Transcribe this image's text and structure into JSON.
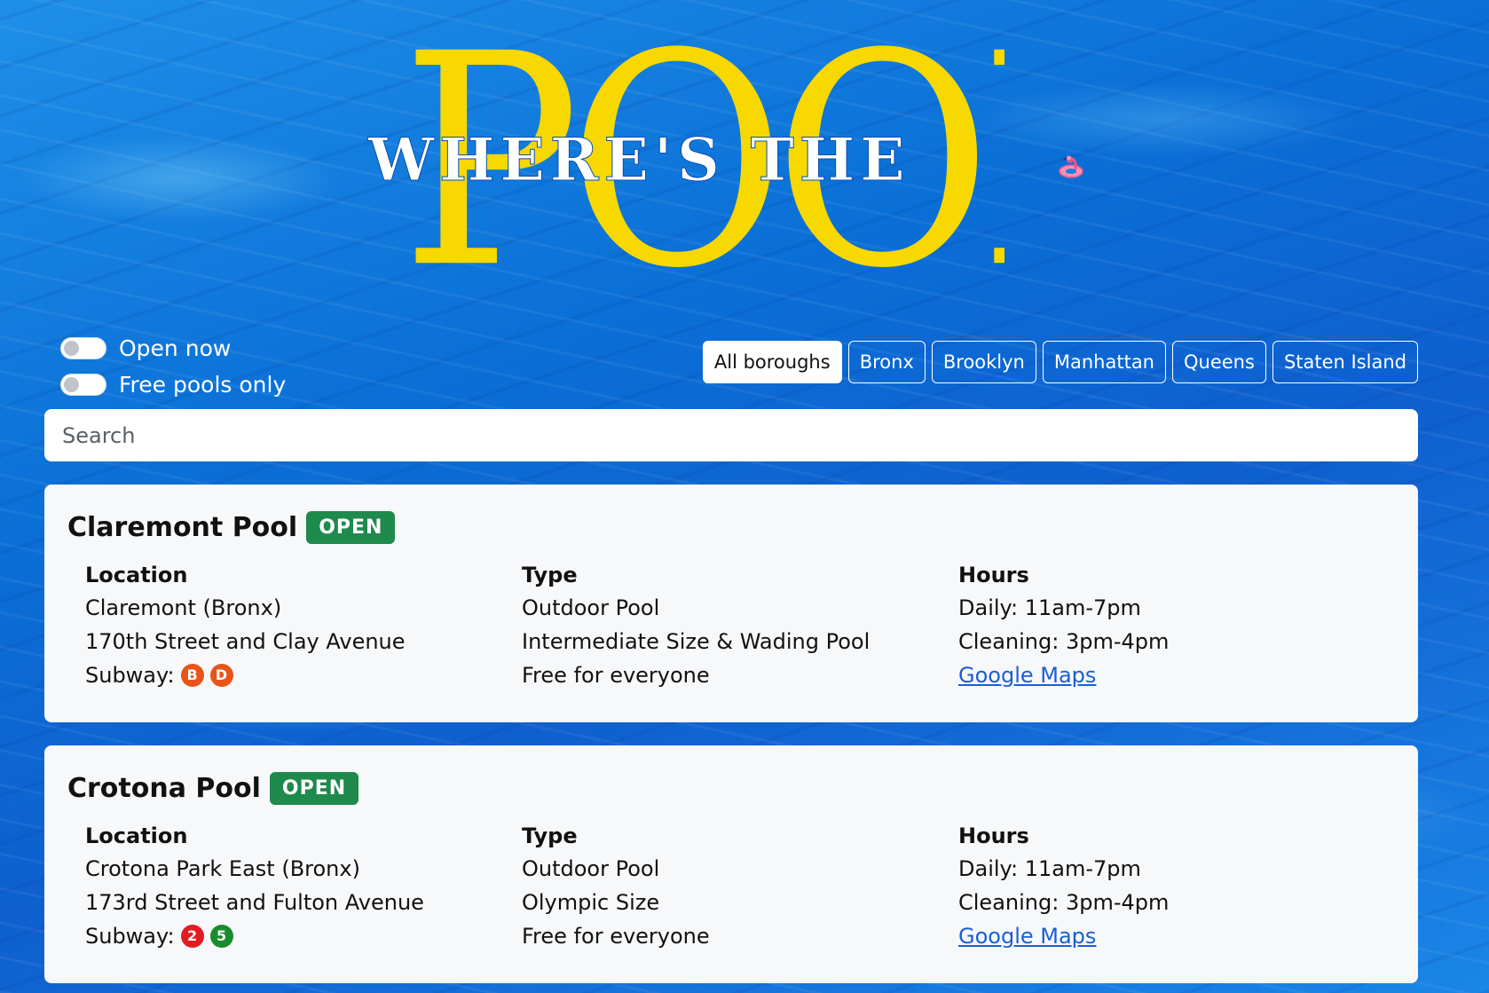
{
  "title": {
    "line1": "WHERE'S THE",
    "line2": "POOLS?"
  },
  "filters": {
    "open_now_label": "Open now",
    "free_only_label": "Free pools only",
    "boroughs": [
      "All boroughs",
      "Bronx",
      "Brooklyn",
      "Manhattan",
      "Queens",
      "Staten Island"
    ],
    "active_borough": "All boroughs"
  },
  "search": {
    "placeholder": "Search",
    "value": ""
  },
  "pools": [
    {
      "name": "Claremont Pool",
      "status": "OPEN",
      "location_label": "Location",
      "location": "Claremont (Bronx)",
      "address": "170th Street and Clay Avenue",
      "subway_label": "Subway:",
      "subway_lines": [
        {
          "line": "B",
          "color": "#e9541a"
        },
        {
          "line": "D",
          "color": "#e9541a"
        }
      ],
      "type_label": "Type",
      "type": "Outdoor Pool",
      "size": "Intermediate Size & Wading Pool",
      "fee": "Free for everyone",
      "hours_label": "Hours",
      "hours": "Daily: 11am-7pm",
      "cleaning": "Cleaning: 3pm-4pm",
      "maps_label": "Google Maps"
    },
    {
      "name": "Crotona Pool",
      "status": "OPEN",
      "location_label": "Location",
      "location": "Crotona Park East (Bronx)",
      "address": "173rd Street and Fulton Avenue",
      "subway_label": "Subway:",
      "subway_lines": [
        {
          "line": "2",
          "color": "#e11b22"
        },
        {
          "line": "5",
          "color": "#1a8c2e"
        }
      ],
      "type_label": "Type",
      "type": "Outdoor Pool",
      "size": "Olympic Size",
      "fee": "Free for everyone",
      "hours_label": "Hours",
      "hours": "Daily: 11am-7pm",
      "cleaning": "Cleaning: 3pm-4pm",
      "maps_label": "Google Maps"
    }
  ],
  "colors": {
    "title_yellow": "#f7d800",
    "open_badge": "#1e8a4c",
    "link": "#1a5fd6"
  },
  "icons": {
    "title_decoration": "flamingo-float-icon"
  }
}
